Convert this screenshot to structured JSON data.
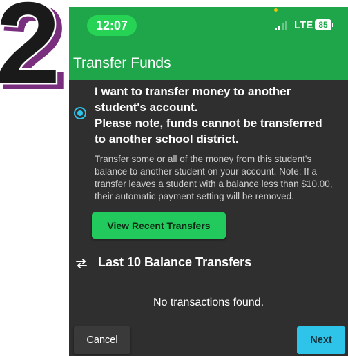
{
  "step_badge": {
    "number": "2"
  },
  "status_bar": {
    "time": "12:07",
    "network": "LTE",
    "battery": "85"
  },
  "header": {
    "title": "Transfer Funds"
  },
  "transfer_option": {
    "title_line1": "I want to transfer money to another",
    "title_line2": "student's account.",
    "note_line1": "Please note, funds cannot be transferred",
    "note_line2": "to another school district.",
    "description": "Transfer some or all of the money from this student's balance to another student on your account. Note: If a transfer leaves a student with a balance less than $10.00, their automatic payment setting will be removed.",
    "selected": true
  },
  "buttons": {
    "view_recent": "View Recent Transfers",
    "cancel": "Cancel",
    "next": "Next"
  },
  "transfers_section": {
    "title": "Last 10 Balance Transfers",
    "empty_text": "No transactions found.",
    "icon": "swap-arrows-icon"
  },
  "colors": {
    "header": "#1fa64a",
    "time_pill": "#26d354",
    "background": "#2f2f2f",
    "accent": "#2ec3e8",
    "button_green": "#22c95c",
    "badge_purple": "#7a2e7e"
  }
}
